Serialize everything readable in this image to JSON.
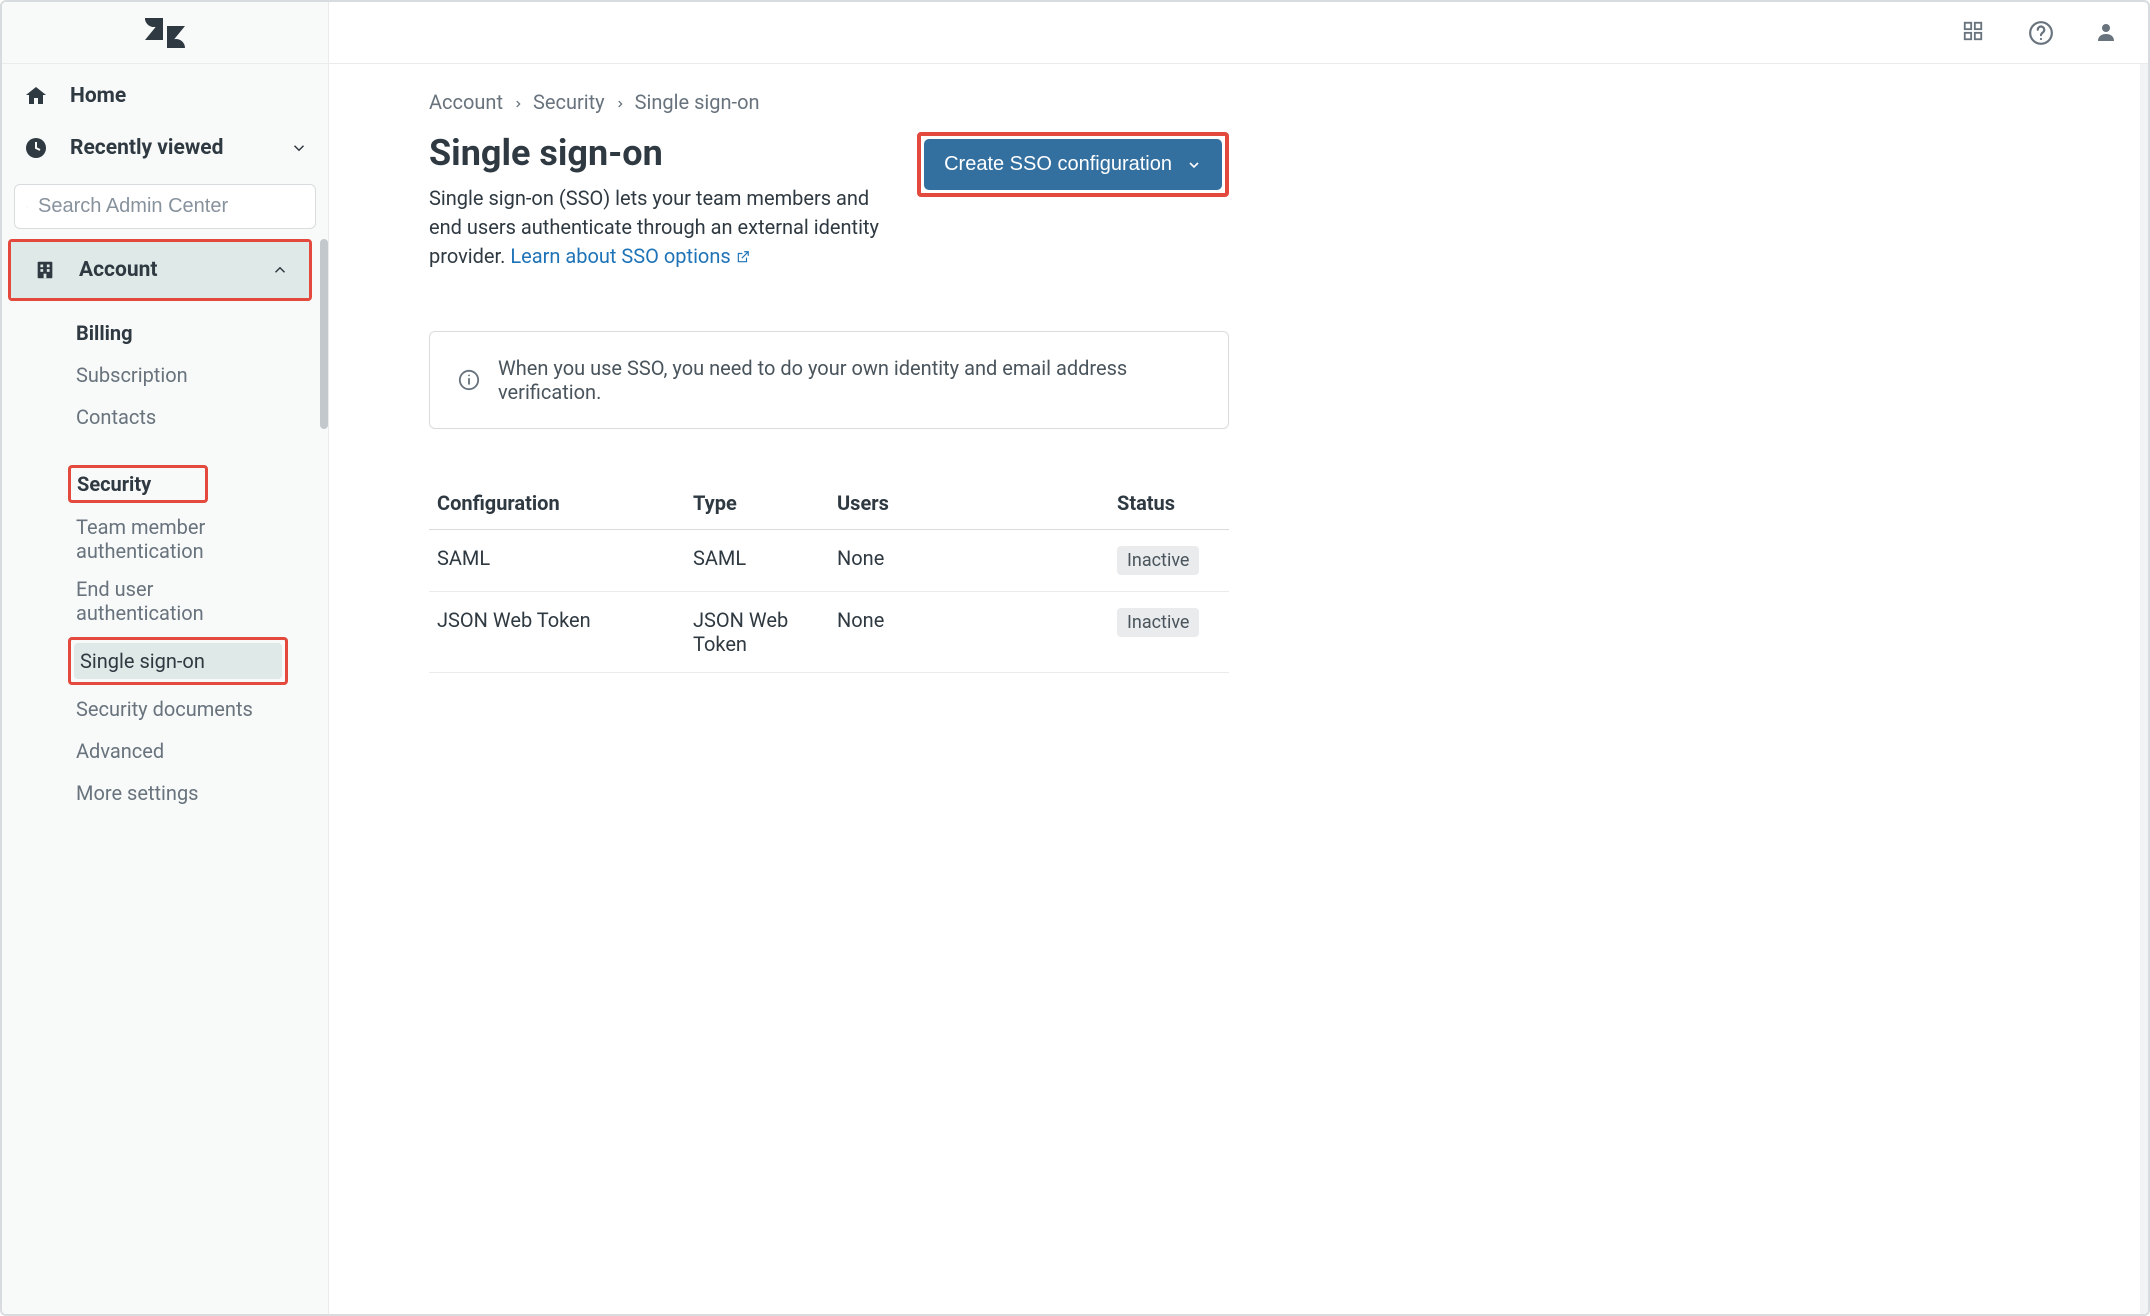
{
  "sidebar": {
    "home_label": "Home",
    "recent_label": "Recently viewed",
    "search_placeholder": "Search Admin Center",
    "section": {
      "label": "Account",
      "items": [
        {
          "label": "Billing"
        },
        {
          "label": "Subscription"
        },
        {
          "label": "Contacts"
        }
      ],
      "security_group": {
        "label": "Security",
        "items": [
          {
            "label": "Team member authentication"
          },
          {
            "label": "End user authentication"
          },
          {
            "label": "Single sign-on"
          },
          {
            "label": "Security documents"
          },
          {
            "label": "Advanced"
          },
          {
            "label": "More settings"
          }
        ]
      }
    }
  },
  "breadcrumb": {
    "a": "Account",
    "b": "Security",
    "c": "Single sign-on"
  },
  "page": {
    "title": "Single sign-on",
    "desc_1": "Single sign-on (SSO) lets your team members and end users authenticate through an external identity provider. ",
    "link_label": "Learn about SSO options",
    "create_button": "Create SSO configuration"
  },
  "banner": {
    "text": "When you use SSO, you need to do your own identity and email address verification."
  },
  "table": {
    "headers": {
      "config": "Configuration",
      "type": "Type",
      "users": "Users",
      "status": "Status"
    },
    "rows": [
      {
        "config": "SAML",
        "type": "SAML",
        "users": "None",
        "status": "Inactive"
      },
      {
        "config": "JSON Web Token",
        "type": "JSON Web Token",
        "users": "None",
        "status": "Inactive"
      }
    ]
  }
}
